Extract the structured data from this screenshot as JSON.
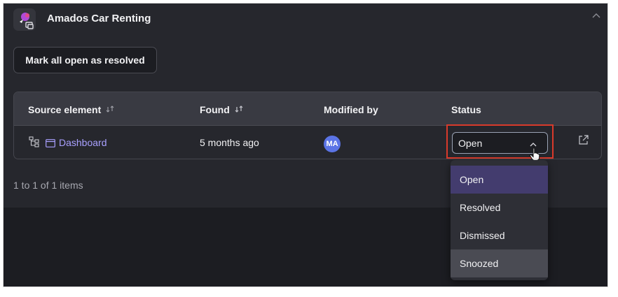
{
  "app": {
    "title": "Amados Car Renting",
    "icon": "app-logo-icon"
  },
  "actions": {
    "mark_resolved_label": "Mark all open as resolved"
  },
  "table": {
    "columns": [
      {
        "label": "Source element",
        "sortable": true
      },
      {
        "label": "Found",
        "sortable": true
      },
      {
        "label": "Modified by",
        "sortable": false
      },
      {
        "label": "Status",
        "sortable": false
      }
    ],
    "rows": [
      {
        "source_element": "Dashboard",
        "found": "5 months ago",
        "modified_by_initials": "MA",
        "status": "Open"
      }
    ]
  },
  "pagination": {
    "summary": "1 to 1 of 1 items"
  },
  "status_dropdown": {
    "selected": "Open",
    "options": [
      "Open",
      "Resolved",
      "Dismissed",
      "Snoozed"
    ]
  },
  "colors": {
    "accent_link": "#a9a0ff",
    "highlight_border": "#d93a2b",
    "avatar": "#5b74e6",
    "selected_option": "#433c6e"
  }
}
